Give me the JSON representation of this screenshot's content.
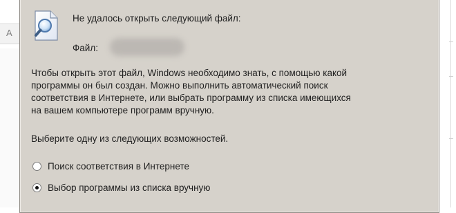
{
  "background": {
    "left_glyph": "A"
  },
  "dialog": {
    "heading": "Не удалось открыть следующий файл:",
    "file_label": "Файл:",
    "description_lines": [
      "Чтобы открыть этот файл, Windows необходимо знать, с помощью какой",
      "программы он был создан. Можно выполнить автоматический поиск",
      "соответствия в Интернете, или выбрать программу из списка имеющихся",
      "на вашем компьютере программ вручную."
    ],
    "prompt": "Выберите одну из следующих возможностей.",
    "options": [
      {
        "label": "Поиск соответствия в Интернете",
        "selected": false
      },
      {
        "label": "Выбор программы из списка вручную",
        "selected": true
      }
    ],
    "icon": "file-search-icon",
    "colors": {
      "dialog_background": "#d6d2cb",
      "text": "#1f1f1f"
    }
  }
}
